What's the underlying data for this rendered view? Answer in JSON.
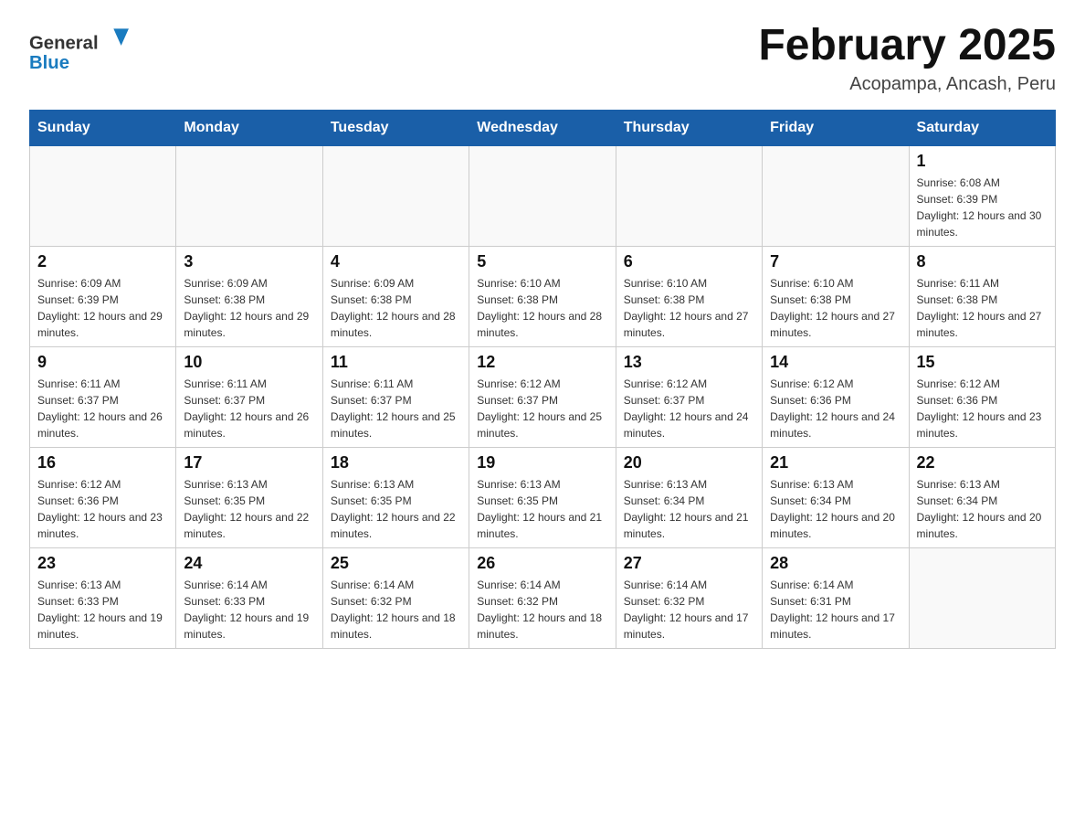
{
  "header": {
    "logo_text_general": "General",
    "logo_text_blue": "Blue",
    "month_title": "February 2025",
    "location": "Acopampa, Ancash, Peru"
  },
  "days_of_week": [
    "Sunday",
    "Monday",
    "Tuesday",
    "Wednesday",
    "Thursday",
    "Friday",
    "Saturday"
  ],
  "weeks": [
    [
      {
        "day": "",
        "info": ""
      },
      {
        "day": "",
        "info": ""
      },
      {
        "day": "",
        "info": ""
      },
      {
        "day": "",
        "info": ""
      },
      {
        "day": "",
        "info": ""
      },
      {
        "day": "",
        "info": ""
      },
      {
        "day": "1",
        "info": "Sunrise: 6:08 AM\nSunset: 6:39 PM\nDaylight: 12 hours and 30 minutes."
      }
    ],
    [
      {
        "day": "2",
        "info": "Sunrise: 6:09 AM\nSunset: 6:39 PM\nDaylight: 12 hours and 29 minutes."
      },
      {
        "day": "3",
        "info": "Sunrise: 6:09 AM\nSunset: 6:38 PM\nDaylight: 12 hours and 29 minutes."
      },
      {
        "day": "4",
        "info": "Sunrise: 6:09 AM\nSunset: 6:38 PM\nDaylight: 12 hours and 28 minutes."
      },
      {
        "day": "5",
        "info": "Sunrise: 6:10 AM\nSunset: 6:38 PM\nDaylight: 12 hours and 28 minutes."
      },
      {
        "day": "6",
        "info": "Sunrise: 6:10 AM\nSunset: 6:38 PM\nDaylight: 12 hours and 27 minutes."
      },
      {
        "day": "7",
        "info": "Sunrise: 6:10 AM\nSunset: 6:38 PM\nDaylight: 12 hours and 27 minutes."
      },
      {
        "day": "8",
        "info": "Sunrise: 6:11 AM\nSunset: 6:38 PM\nDaylight: 12 hours and 27 minutes."
      }
    ],
    [
      {
        "day": "9",
        "info": "Sunrise: 6:11 AM\nSunset: 6:37 PM\nDaylight: 12 hours and 26 minutes."
      },
      {
        "day": "10",
        "info": "Sunrise: 6:11 AM\nSunset: 6:37 PM\nDaylight: 12 hours and 26 minutes."
      },
      {
        "day": "11",
        "info": "Sunrise: 6:11 AM\nSunset: 6:37 PM\nDaylight: 12 hours and 25 minutes."
      },
      {
        "day": "12",
        "info": "Sunrise: 6:12 AM\nSunset: 6:37 PM\nDaylight: 12 hours and 25 minutes."
      },
      {
        "day": "13",
        "info": "Sunrise: 6:12 AM\nSunset: 6:37 PM\nDaylight: 12 hours and 24 minutes."
      },
      {
        "day": "14",
        "info": "Sunrise: 6:12 AM\nSunset: 6:36 PM\nDaylight: 12 hours and 24 minutes."
      },
      {
        "day": "15",
        "info": "Sunrise: 6:12 AM\nSunset: 6:36 PM\nDaylight: 12 hours and 23 minutes."
      }
    ],
    [
      {
        "day": "16",
        "info": "Sunrise: 6:12 AM\nSunset: 6:36 PM\nDaylight: 12 hours and 23 minutes."
      },
      {
        "day": "17",
        "info": "Sunrise: 6:13 AM\nSunset: 6:35 PM\nDaylight: 12 hours and 22 minutes."
      },
      {
        "day": "18",
        "info": "Sunrise: 6:13 AM\nSunset: 6:35 PM\nDaylight: 12 hours and 22 minutes."
      },
      {
        "day": "19",
        "info": "Sunrise: 6:13 AM\nSunset: 6:35 PM\nDaylight: 12 hours and 21 minutes."
      },
      {
        "day": "20",
        "info": "Sunrise: 6:13 AM\nSunset: 6:34 PM\nDaylight: 12 hours and 21 minutes."
      },
      {
        "day": "21",
        "info": "Sunrise: 6:13 AM\nSunset: 6:34 PM\nDaylight: 12 hours and 20 minutes."
      },
      {
        "day": "22",
        "info": "Sunrise: 6:13 AM\nSunset: 6:34 PM\nDaylight: 12 hours and 20 minutes."
      }
    ],
    [
      {
        "day": "23",
        "info": "Sunrise: 6:13 AM\nSunset: 6:33 PM\nDaylight: 12 hours and 19 minutes."
      },
      {
        "day": "24",
        "info": "Sunrise: 6:14 AM\nSunset: 6:33 PM\nDaylight: 12 hours and 19 minutes."
      },
      {
        "day": "25",
        "info": "Sunrise: 6:14 AM\nSunset: 6:32 PM\nDaylight: 12 hours and 18 minutes."
      },
      {
        "day": "26",
        "info": "Sunrise: 6:14 AM\nSunset: 6:32 PM\nDaylight: 12 hours and 18 minutes."
      },
      {
        "day": "27",
        "info": "Sunrise: 6:14 AM\nSunset: 6:32 PM\nDaylight: 12 hours and 17 minutes."
      },
      {
        "day": "28",
        "info": "Sunrise: 6:14 AM\nSunset: 6:31 PM\nDaylight: 12 hours and 17 minutes."
      },
      {
        "day": "",
        "info": ""
      }
    ]
  ]
}
